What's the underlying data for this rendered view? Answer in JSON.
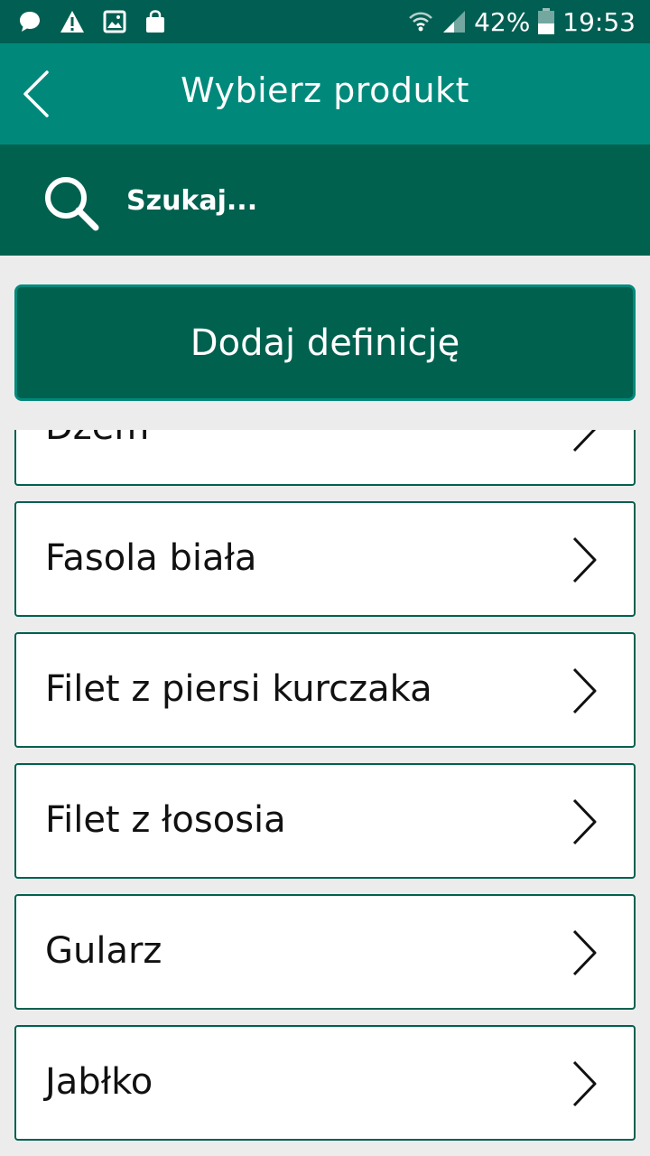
{
  "status_bar": {
    "icons": [
      "chat-icon",
      "warning-icon",
      "image-icon",
      "shopping-bag-icon",
      "wifi-icon",
      "signal-icon",
      "battery-icon"
    ],
    "battery": "42%",
    "time": "19:53"
  },
  "app_bar": {
    "title": "Wybierz produkt",
    "back_icon": "chevron-left-icon"
  },
  "search": {
    "placeholder": "Szukaj..."
  },
  "add_button": {
    "label": "Dodaj definicję"
  },
  "products": [
    {
      "label": "Dżem"
    },
    {
      "label": "Fasola biała"
    },
    {
      "label": "Filet z piersi kurczaka"
    },
    {
      "label": "Filet z łososia"
    },
    {
      "label": "Gularz"
    },
    {
      "label": "Jabłko"
    }
  ],
  "colors": {
    "status_bar": "#005f52",
    "app_bar": "#00897b",
    "search_bar": "#00614f",
    "add_button": "#00614f",
    "background": "#ececec",
    "item_border": "#00614f"
  }
}
